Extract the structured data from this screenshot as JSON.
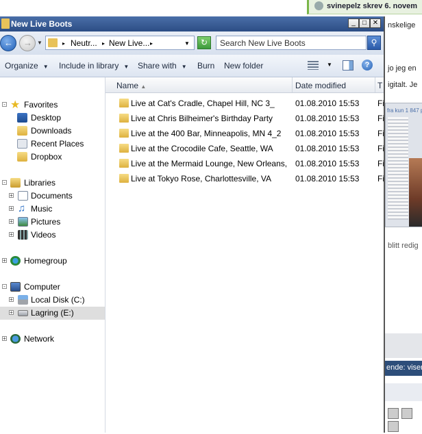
{
  "background": {
    "notification": "svinepelz skrev 6. novem",
    "text1": "nskelige",
    "text2": "jo jeg en",
    "text3": "igitalt. Je",
    "text4": "blitt redig",
    "bar_text": "ende: viser",
    "photo_caption": "fra kun 1 847 p"
  },
  "window": {
    "title": "New Live Boots",
    "controls": {
      "minimize": "_",
      "maximize": "□",
      "close": "✕"
    }
  },
  "address": {
    "crumbs": [
      "Neutr...",
      "New Live..."
    ],
    "search_placeholder": "Search New Live Boots"
  },
  "commands": {
    "organize": "Organize",
    "include": "Include in library",
    "share": "Share with",
    "burn": "Burn",
    "new_folder": "New folder"
  },
  "nav": {
    "favorites": "Favorites",
    "desktop": "Desktop",
    "downloads": "Downloads",
    "recent": "Recent Places",
    "dropbox": "Dropbox",
    "libraries": "Libraries",
    "documents": "Documents",
    "music": "Music",
    "pictures": "Pictures",
    "videos": "Videos",
    "homegroup": "Homegroup",
    "computer": "Computer",
    "local_disk": "Local Disk (C:)",
    "lagring": "Lagring (E:)",
    "network": "Network"
  },
  "columns": {
    "name": "Name",
    "date": "Date modified",
    "type": "T"
  },
  "files": [
    {
      "name": "Live at Cat's Cradle, Chapel Hill, NC 3_",
      "date": "01.08.2010 15:53",
      "type": "Fi"
    },
    {
      "name": "Live at Chris Bilheimer's Birthday Party",
      "date": "01.08.2010 15:53",
      "type": "Fi"
    },
    {
      "name": "Live at the 400 Bar, Minneapolis, MN 4_2",
      "date": "01.08.2010 15:53",
      "type": "Fi"
    },
    {
      "name": "Live at the Crocodile Cafe, Seattle, WA",
      "date": "01.08.2010 15:53",
      "type": "Fi"
    },
    {
      "name": "Live at the Mermaid Lounge, New Orleans,",
      "date": "01.08.2010 15:53",
      "type": "Fi"
    },
    {
      "name": "Live at Tokyo Rose, Charlottesville, VA",
      "date": "01.08.2010 15:53",
      "type": "Fi"
    }
  ]
}
